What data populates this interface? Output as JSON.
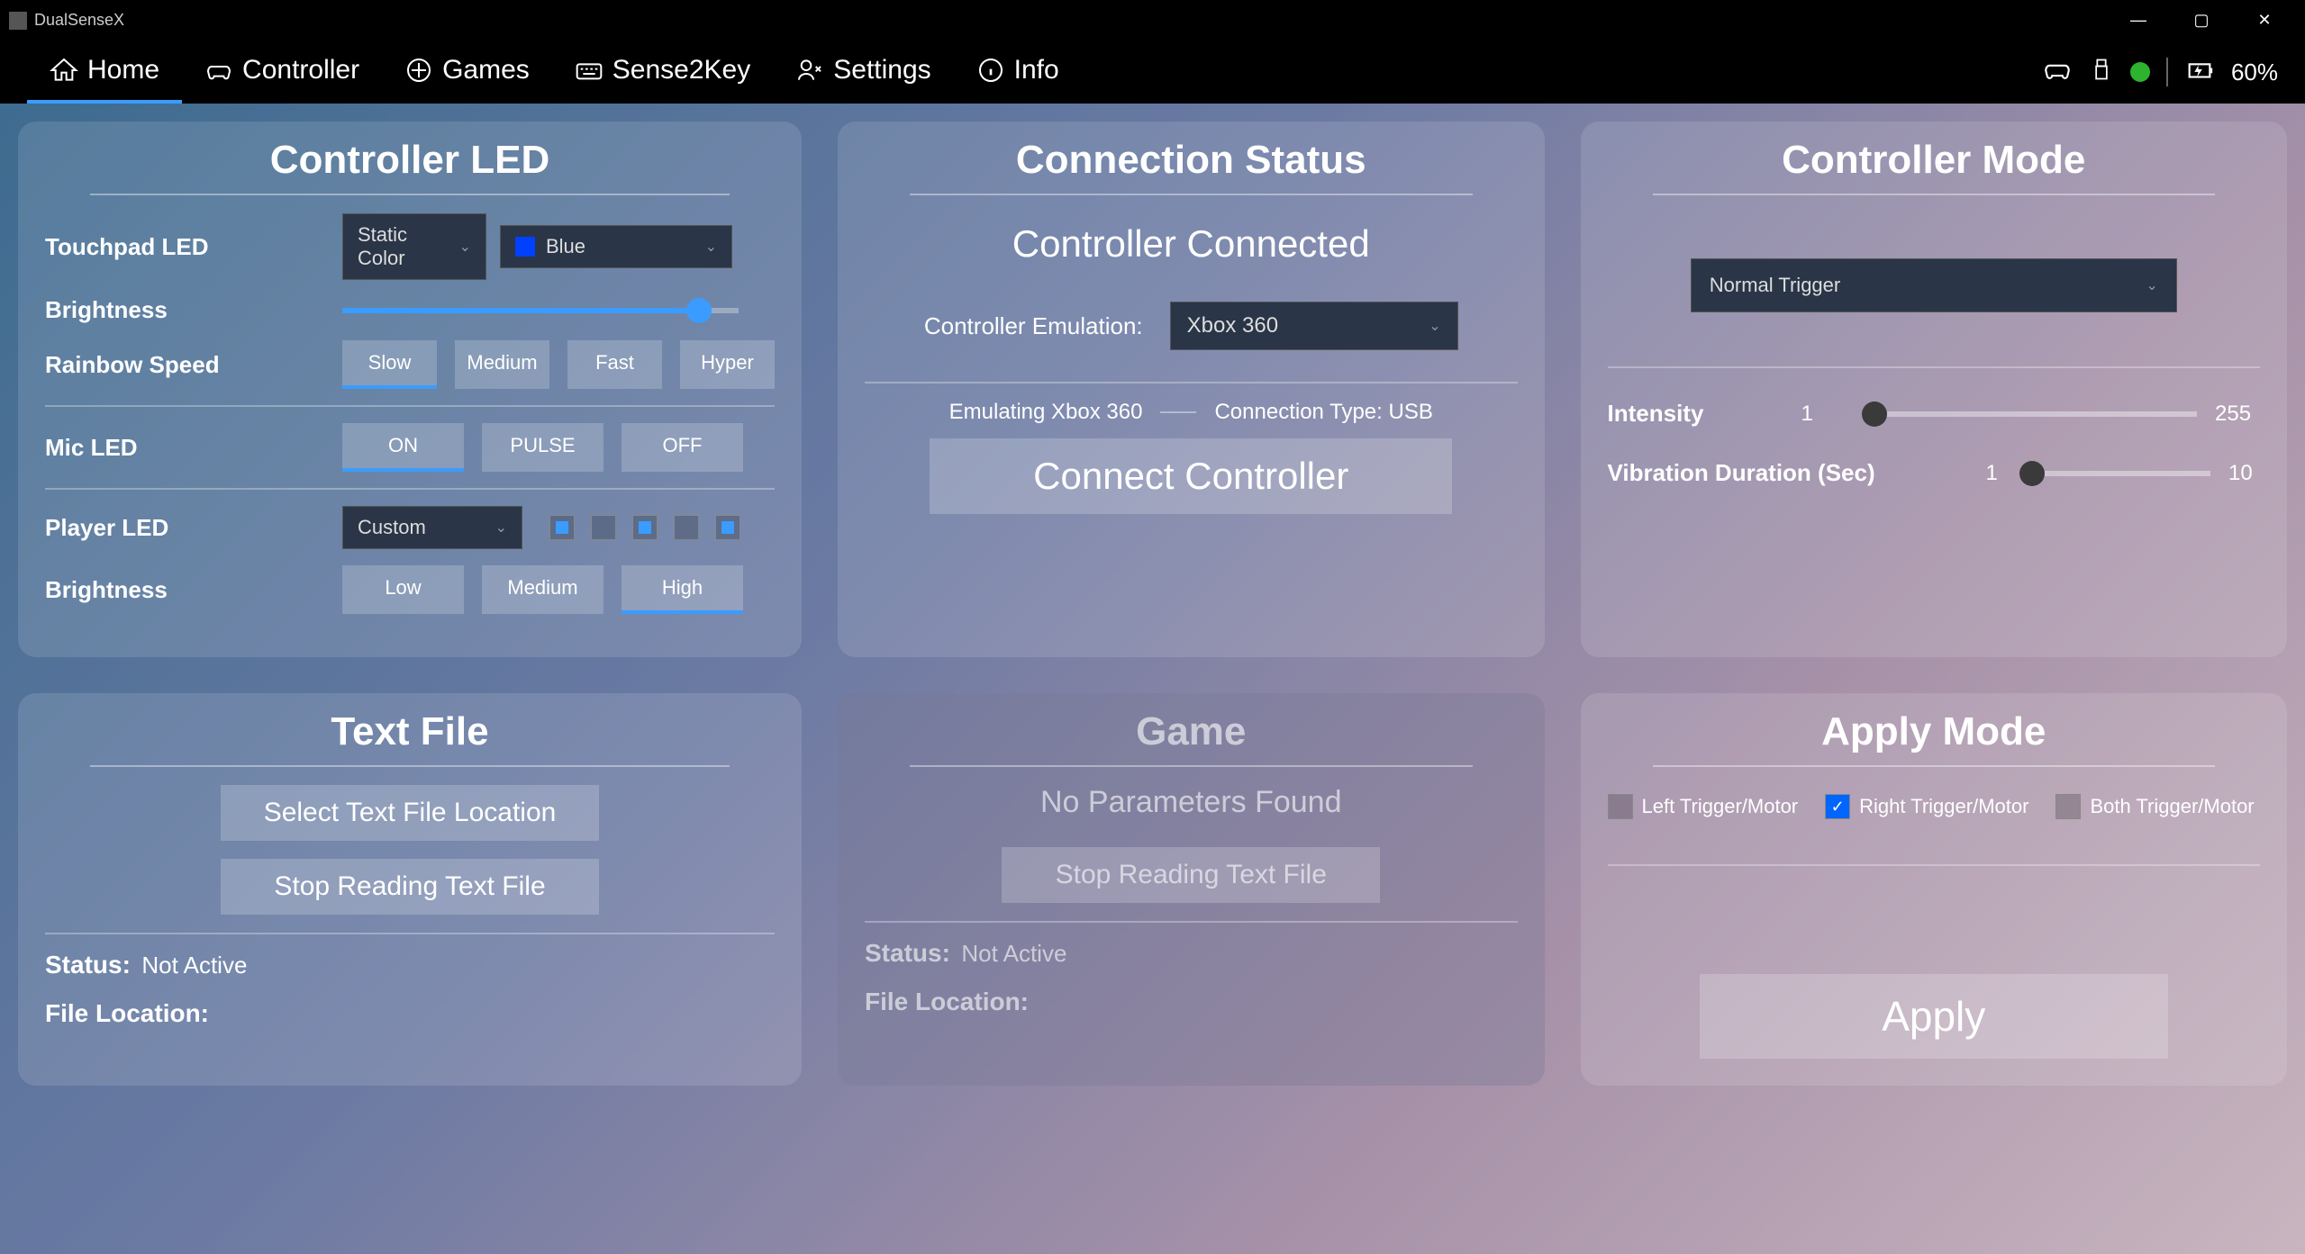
{
  "app": {
    "title": "DualSenseX",
    "battery": "60%"
  },
  "nav": [
    "Home",
    "Controller",
    "Games",
    "Sense2Key",
    "Settings",
    "Info"
  ],
  "led": {
    "title": "Controller LED",
    "touchpad_label": "Touchpad LED",
    "mode": "Static Color",
    "color": "Blue",
    "brightness_label": "Brightness",
    "rainbow_label": "Rainbow Speed",
    "rainbow_opts": [
      "Slow",
      "Medium",
      "Fast",
      "Hyper"
    ],
    "mic_label": "Mic LED",
    "mic_opts": [
      "ON",
      "PULSE",
      "OFF"
    ],
    "player_label": "Player LED",
    "player_mode": "Custom",
    "player_brightness_label": "Brightness",
    "pbright_opts": [
      "Low",
      "Medium",
      "High"
    ]
  },
  "conn": {
    "title": "Connection Status",
    "status": "Controller Connected",
    "emul_label": "Controller Emulation:",
    "emul_value": "Xbox 360",
    "emulating": "Emulating Xbox 360",
    "conn_type": "Connection Type: USB",
    "connect_btn": "Connect Controller"
  },
  "mode": {
    "title": "Controller Mode",
    "trigger": "Normal Trigger",
    "intensity_label": "Intensity",
    "intensity_min": "1",
    "intensity_max": "255",
    "duration_label": "Vibration Duration (Sec)",
    "duration_min": "1",
    "duration_max": "10"
  },
  "textfile": {
    "title": "Text File",
    "select_btn": "Select Text File Location",
    "stop_btn": "Stop Reading Text File",
    "status_label": "Status:",
    "status_val": "Not Active",
    "loc_label": "File Location:",
    "loc_val": ""
  },
  "game": {
    "title": "Game",
    "noparams": "No Parameters Found",
    "stop_btn": "Stop Reading Text File",
    "status_label": "Status:",
    "status_val": "Not Active",
    "loc_label": "File Location:",
    "loc_val": ""
  },
  "apply": {
    "title": "Apply Mode",
    "left": "Left Trigger/Motor",
    "right": "Right Trigger/Motor",
    "both": "Both Trigger/Motor",
    "apply_btn": "Apply"
  }
}
